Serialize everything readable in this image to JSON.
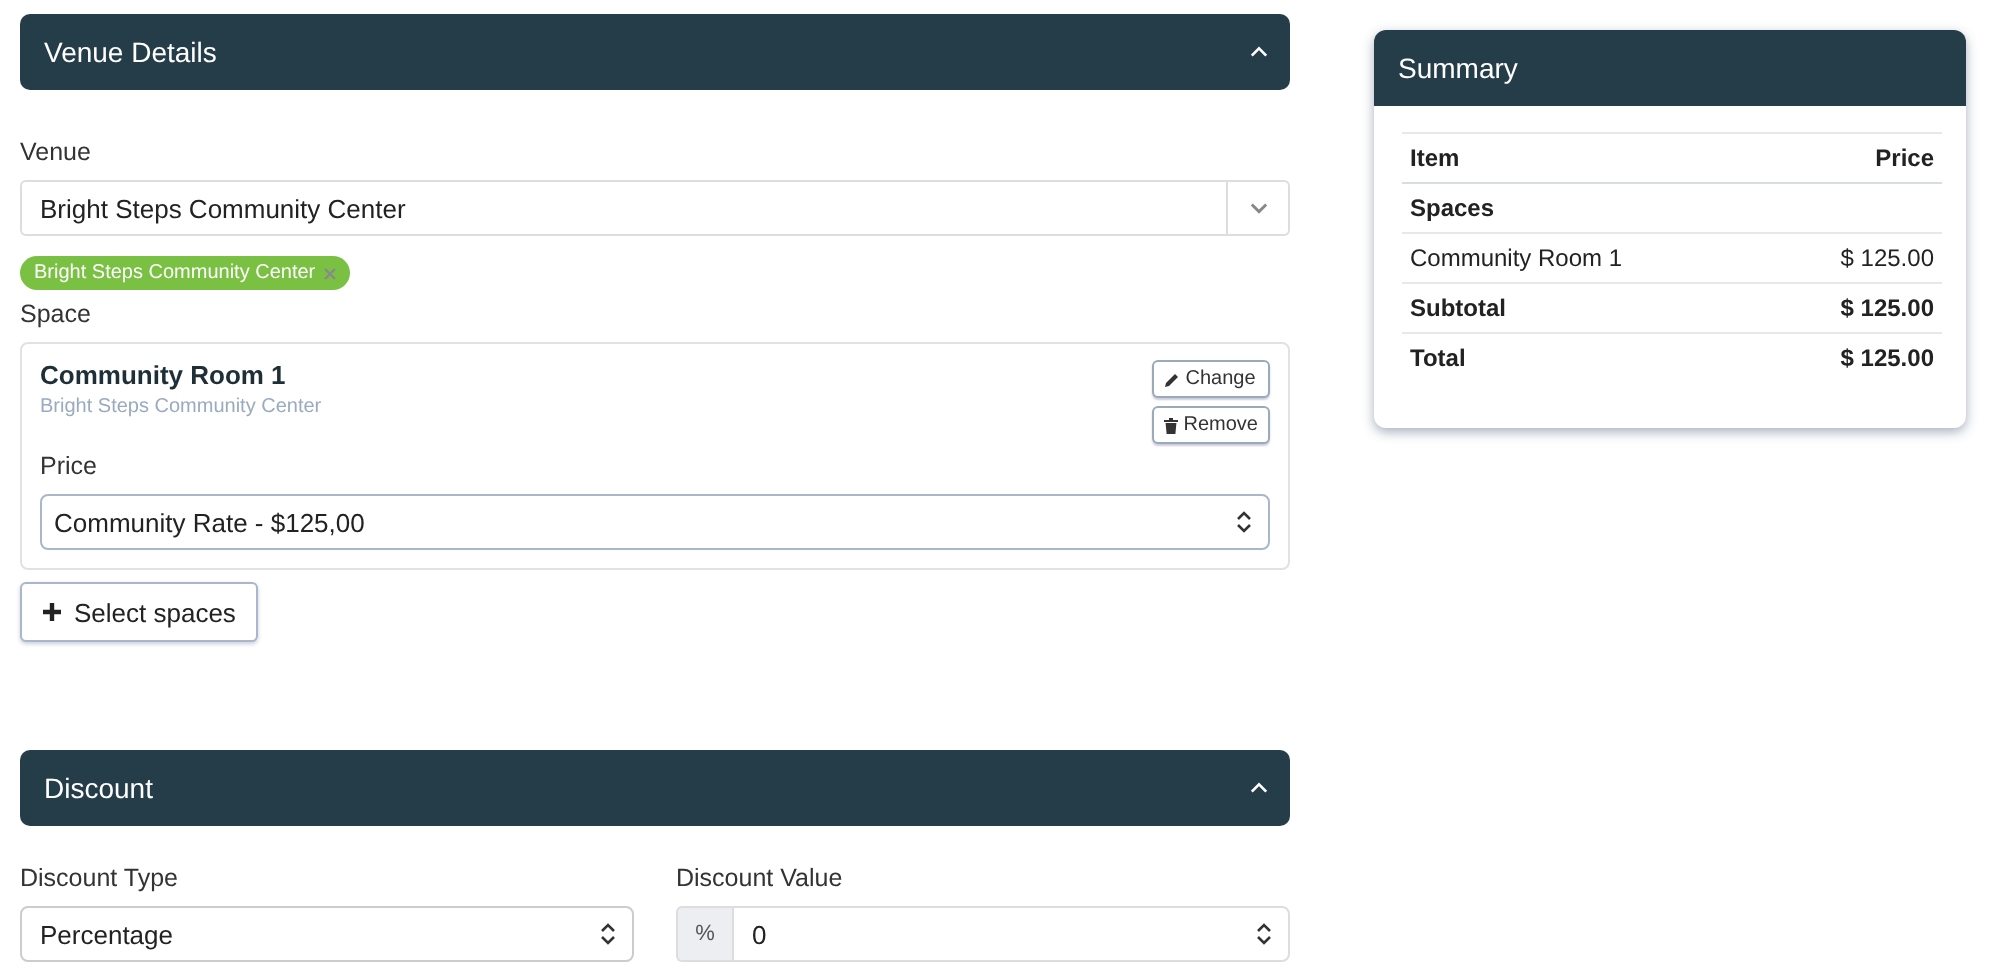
{
  "venue_section": {
    "title": "Venue Details",
    "expanded": true,
    "venue": {
      "label": "Venue",
      "value": "Bright Steps Community Center",
      "tags": [
        "Bright Steps Community Center"
      ]
    },
    "space": {
      "label": "Space",
      "card": {
        "name": "Community Room 1",
        "venue": "Bright Steps Community Center",
        "buttons": [
          "Change",
          "Remove"
        ],
        "price_label": "Price",
        "price": "Community Rate - $125,00"
      }
    },
    "select_button": "Select spaces"
  },
  "discount_section": {
    "title": "Discount",
    "expanded": true,
    "type": {
      "label": "Discount Type",
      "value": "Percentage"
    },
    "value": {
      "label": "Discount Value",
      "prefix": "%",
      "value": "0"
    }
  },
  "summary": {
    "title": "Summary",
    "columns": [
      "Item",
      "Price"
    ],
    "rows": [
      {
        "kind": "group",
        "item": "Spaces"
      },
      {
        "kind": "item",
        "item": "Community Room 1",
        "price": "$ 125.00"
      },
      {
        "kind": "total",
        "item": "Subtotal",
        "price": "$ 125.00"
      },
      {
        "kind": "total",
        "item": "Total",
        "price": "$ 125.00"
      }
    ]
  }
}
